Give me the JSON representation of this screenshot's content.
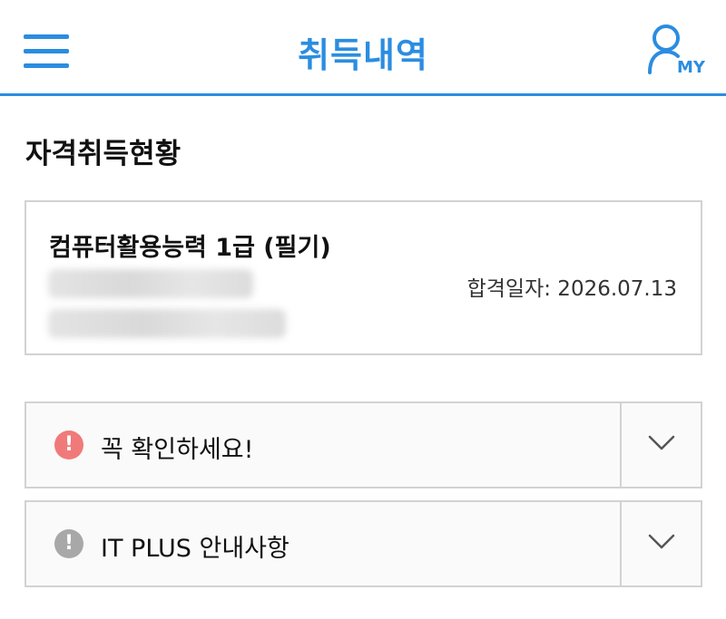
{
  "header": {
    "title": "취득내역",
    "my_label": "MY",
    "accent_color": "#2b8de0"
  },
  "section": {
    "title": "자격취득현황"
  },
  "certificate": {
    "name": "컴퓨터활용능력 1급 (필기)",
    "pass_date": "합격일자: 2026.07.13"
  },
  "accordions": [
    {
      "label": "꼭 확인하세요!",
      "icon": "alert-icon",
      "icon_color": "#f07a7a"
    },
    {
      "label": "IT PLUS 안내사항",
      "icon": "info-alert-icon",
      "icon_color": "#a8a8a8"
    }
  ]
}
